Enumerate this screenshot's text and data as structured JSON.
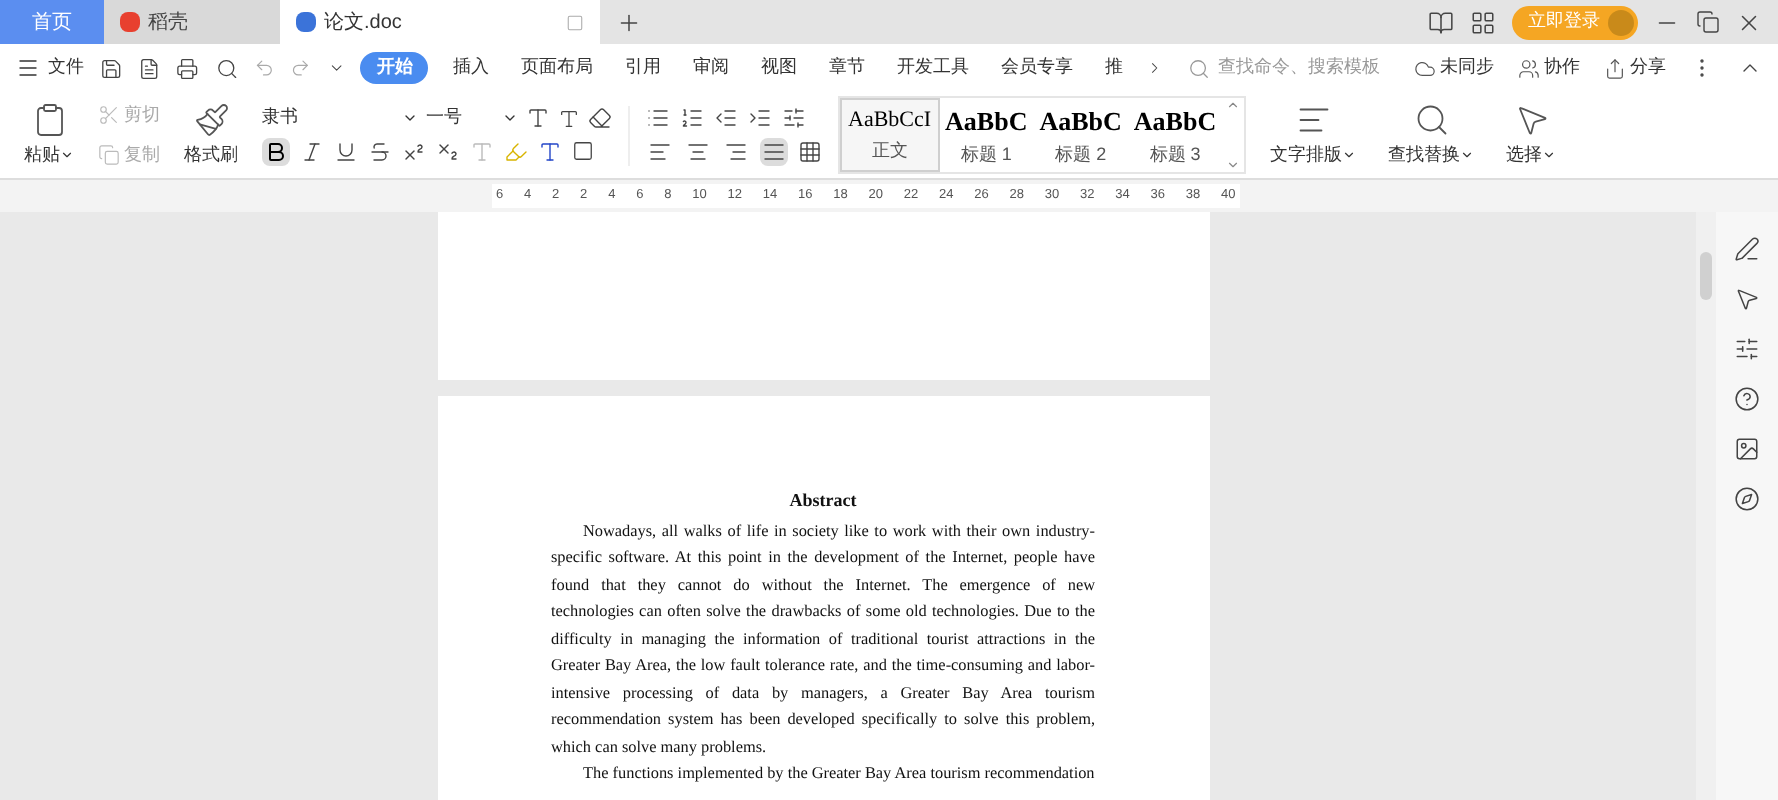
{
  "tabs": [
    {
      "label": "首页",
      "kind": "home",
      "selected": false
    },
    {
      "label": "稻壳",
      "kind": "app",
      "selected": false
    },
    {
      "label": "论文.doc",
      "kind": "doc",
      "selected": true
    }
  ],
  "login_button": "立即登录",
  "menu": {
    "file": "文件",
    "tabs": [
      {
        "label": "开始",
        "selected": true
      },
      {
        "label": "插入",
        "selected": false
      },
      {
        "label": "页面布局",
        "selected": false
      },
      {
        "label": "引用",
        "selected": false
      },
      {
        "label": "审阅",
        "selected": false
      },
      {
        "label": "视图",
        "selected": false
      },
      {
        "label": "章节",
        "selected": false
      },
      {
        "label": "开发工具",
        "selected": false
      },
      {
        "label": "会员专享",
        "selected": false
      },
      {
        "label": "推",
        "selected": false
      }
    ],
    "search": {
      "placeholder": "查找命令、搜索模板"
    },
    "sync": "未同步",
    "collaborate": "协作",
    "share": "分享"
  },
  "ribbon": {
    "paste": "粘贴",
    "cut": "剪切",
    "copy": "复制",
    "format_painter": "格式刷",
    "font": "隶书",
    "size": "一号",
    "bold_on": true,
    "align": [
      {
        "kind": "left",
        "selected": false
      },
      {
        "kind": "center",
        "selected": false
      },
      {
        "kind": "right",
        "selected": false
      },
      {
        "kind": "justify",
        "selected": true
      }
    ],
    "styles": [
      {
        "preview": "AaBbCcI",
        "label": "正文",
        "kind": "normal",
        "selected": true
      },
      {
        "preview": "AaBbC",
        "label": "标题 1",
        "kind": "heading",
        "selected": false
      },
      {
        "preview": "AaBbC",
        "label": "标题 2",
        "kind": "heading",
        "selected": false
      },
      {
        "preview": "AaBbC",
        "label": "标题 3",
        "kind": "heading",
        "selected": false
      }
    ],
    "text_layout": "文字排版",
    "find_replace": "查找替换",
    "select": "选择"
  },
  "ruler": [
    "6",
    "4",
    "2",
    "2",
    "4",
    "6",
    "8",
    "10",
    "12",
    "14",
    "16",
    "18",
    "20",
    "22",
    "24",
    "26",
    "28",
    "30",
    "32",
    "34",
    "36",
    "38",
    "40"
  ],
  "document": {
    "title": "Abstract",
    "paragraphs": [
      "Nowadays, all walks of life in society like to work with their own industry-specific software. At this point in the development of the Internet, people have found that they cannot do without the Internet. The emergence of new technologies can often solve the drawbacks of some old technologies. Due to the difficulty in managing the information of traditional tourist attractions in the Greater Bay Area, the low fault tolerance rate, and the time-consuming and labor-intensive processing of data by managers, a Greater Bay Area tourism recommendation system has been developed specifically to solve this problem, which can solve many problems.",
      "The functions implemented by the Greater Bay Area tourism recommendation"
    ]
  }
}
